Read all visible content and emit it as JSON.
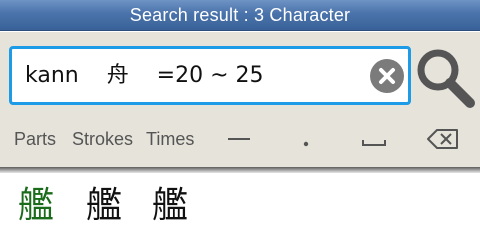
{
  "header": {
    "title": "Search result : 3 Character"
  },
  "search": {
    "query": "kann    舟    =20 ~ 25",
    "clear_icon": "clear-circle-x-icon",
    "search_icon": "magnifier-icon"
  },
  "keyboard": {
    "parts": "Parts",
    "strokes": "Strokes",
    "times": "Times",
    "dash_icon": "dash-icon",
    "dot_icon": "dot-icon",
    "space_icon": "space-icon",
    "backspace_icon": "backspace-icon"
  },
  "results": [
    {
      "char": "艦",
      "color": "#1a6b1a"
    },
    {
      "char": "艦",
      "color": "#111111"
    },
    {
      "char": "艦",
      "color": "#111111"
    }
  ],
  "colors": {
    "accent": "#1e9be6",
    "header": "#4a73ab",
    "panel": "#e6e3da",
    "selected_result": "#1a6b1a"
  }
}
